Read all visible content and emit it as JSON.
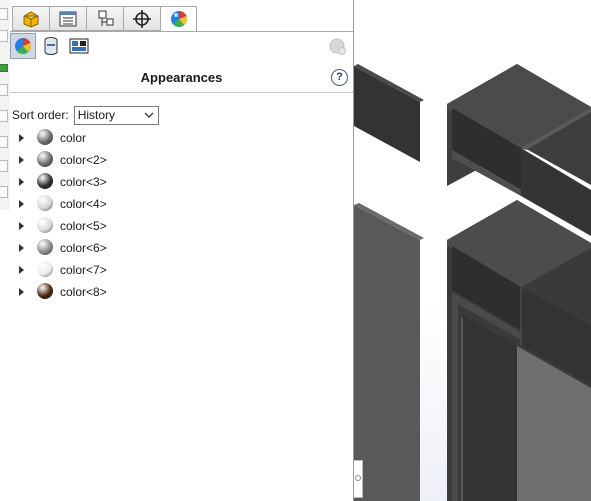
{
  "panel": {
    "tabs": [
      {
        "name": "feature-manager",
        "icon": "parts-icon"
      },
      {
        "name": "property-manager",
        "icon": "property-list-icon"
      },
      {
        "name": "configuration-manager",
        "icon": "configuration-icon"
      },
      {
        "name": "dimxpert-manager",
        "icon": "crosshair-icon"
      },
      {
        "name": "display-manager",
        "icon": "appearance-ball-icon",
        "active": true
      }
    ],
    "subtools": [
      "appearances-icon",
      "decals-icon",
      "scenes-icon"
    ],
    "title": "Appearances",
    "sort": {
      "label": "Sort order:",
      "value": "History"
    },
    "items": [
      {
        "label": "color",
        "color": "#6a6a6a"
      },
      {
        "label": "color<2>",
        "color": "#6c6c6c"
      },
      {
        "label": "color<3>",
        "color": "#2f2f2f"
      },
      {
        "label": "color<4>",
        "color": "#d6d6d6"
      },
      {
        "label": "color<5>",
        "color": "#dcdcdc"
      },
      {
        "label": "color<6>",
        "color": "#8a8a8a"
      },
      {
        "label": "color<7>",
        "color": "#ececec"
      },
      {
        "label": "color<8>",
        "color": "#4a2410"
      }
    ]
  },
  "colors": {
    "model_dark": "#3c3c3c",
    "model_mid": "#555555",
    "model_light": "#6e6e6e"
  }
}
